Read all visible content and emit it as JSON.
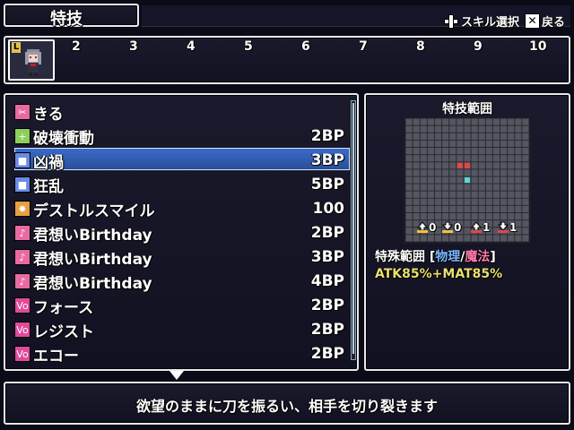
{
  "header": {
    "title": "特技",
    "hint_select": "スキル選択",
    "hint_back": "戻る",
    "back_key_glyph": "✕"
  },
  "party": {
    "active_marker": "L",
    "slots": [
      "2",
      "3",
      "4",
      "5",
      "6",
      "7",
      "8",
      "9",
      "10"
    ]
  },
  "skills": [
    {
      "icon": "scissors-icon",
      "color": "#e86aa0",
      "name": "きる",
      "cost": ""
    },
    {
      "icon": "plus-icon",
      "color": "#8ad05a",
      "name": "破壊衝動",
      "cost": "2BP"
    },
    {
      "icon": "square-icon",
      "color": "#6a8ae8",
      "name": "凶禍",
      "cost": "3BP"
    },
    {
      "icon": "square-icon",
      "color": "#6a8ae8",
      "name": "狂乱",
      "cost": "5BP"
    },
    {
      "icon": "burst-icon",
      "color": "#e8a040",
      "name": "デストルスマイル",
      "cost": "100"
    },
    {
      "icon": "note-icon",
      "color": "#e86aa0",
      "name": "君想いBirthday",
      "cost": "2BP"
    },
    {
      "icon": "note-plus-icon",
      "color": "#e86aa0",
      "name": "君想いBirthday",
      "cost": "3BP"
    },
    {
      "icon": "note-plus2-icon",
      "color": "#e86aa0",
      "name": "君想いBirthday",
      "cost": "4BP"
    },
    {
      "icon": "vo-icon",
      "color": "#e04a9a",
      "name": "フォース",
      "cost": "2BP"
    },
    {
      "icon": "vo-icon",
      "color": "#e04a9a",
      "name": "レジスト",
      "cost": "2BP"
    },
    {
      "icon": "vo-icon",
      "color": "#e04a9a",
      "name": "エコー",
      "cost": "2BP"
    }
  ],
  "selected_index": 2,
  "range": {
    "title": "特技範囲",
    "modifiers": [
      "0",
      "0",
      "1",
      "1"
    ],
    "special_prefix": "特殊範囲 [",
    "special_physical": "物理",
    "special_sep": "/",
    "special_magic": "魔法",
    "special_suffix": "]",
    "formula": "ATK85%+MAT85%",
    "colors": {
      "physical": "#7ab8ff",
      "magic": "#ff7ab0",
      "hit": "#e04848",
      "origin": "#5ad8d8"
    }
  },
  "description": "欲望のままに刀を振るい、相手を切り裂きます"
}
